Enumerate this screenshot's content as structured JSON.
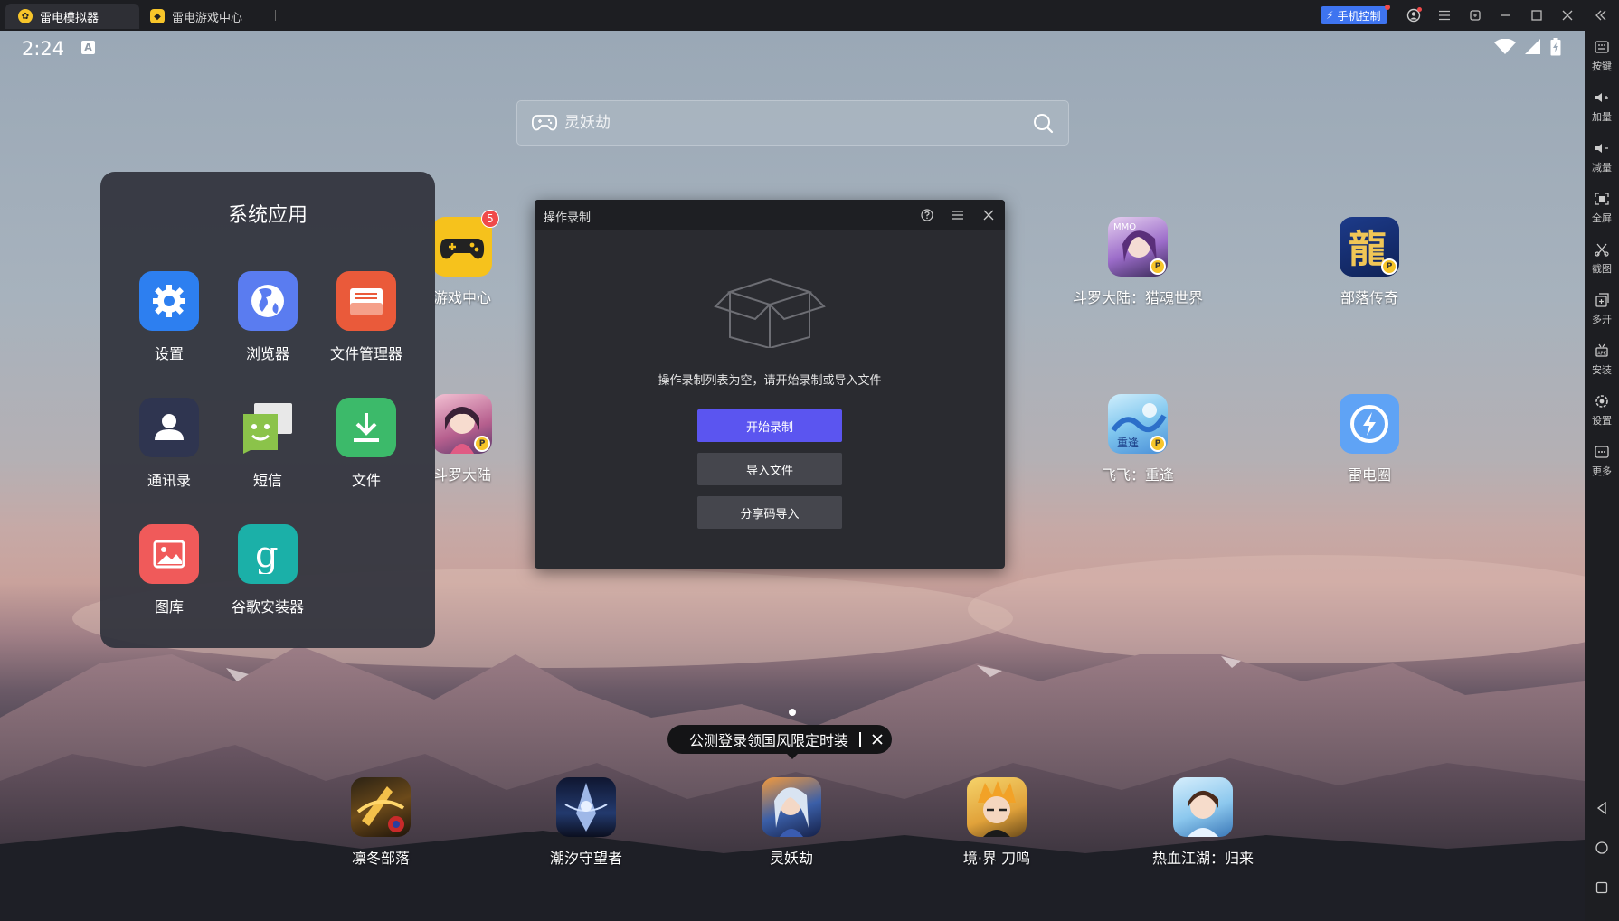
{
  "titlebar": {
    "tabs": [
      {
        "label": "雷电模拟器",
        "active": true
      },
      {
        "label": "雷电游戏中心",
        "active": false
      }
    ],
    "phone_control_label": "手机控制",
    "icons": [
      "account-icon",
      "menu-icon",
      "restore-icon",
      "minimize-icon",
      "maximize-icon",
      "close-icon",
      "collapse-icon"
    ]
  },
  "status_bar": {
    "time": "2:24",
    "a_badge": "A"
  },
  "search": {
    "placeholder": "灵妖劫"
  },
  "desktop_apps": [
    {
      "label": "游戏中心",
      "badge": "5"
    },
    {
      "label": "斗罗大陆"
    },
    {
      "label": "斗罗大陆：猎魂世界"
    },
    {
      "label": "部落传奇"
    },
    {
      "label": "飞飞：重逢"
    },
    {
      "label": "雷电圈"
    }
  ],
  "system_folder": {
    "title": "系统应用",
    "apps": [
      {
        "label": "设置",
        "color": "#2d7ff0"
      },
      {
        "label": "浏览器",
        "color": "#5a7cf0"
      },
      {
        "label": "文件管理器",
        "color": "#ea5a3a"
      },
      {
        "label": "通讯录",
        "color": "#2f3550"
      },
      {
        "label": "短信",
        "color": "#8bc34a"
      },
      {
        "label": "文件",
        "color": "#3cba6a"
      },
      {
        "label": "图库",
        "color": "#f05a5a"
      },
      {
        "label": "谷歌安装器",
        "color": "#1bb0a8"
      }
    ]
  },
  "dialog": {
    "title": "操作录制",
    "empty_text": "操作录制列表为空，请开始录制或导入文件",
    "start_label": "开始录制",
    "import_label": "导入文件",
    "share_code_label": "分享码导入"
  },
  "toast": {
    "text": "公测登录领国风限定时装"
  },
  "dock_apps": [
    {
      "label": "凛冬部落"
    },
    {
      "label": "潮汐守望者"
    },
    {
      "label": "灵妖劫"
    },
    {
      "label": "境·界 刀鸣"
    },
    {
      "label": "热血江湖：归来"
    }
  ],
  "sidebar": {
    "items": [
      {
        "label": "按键"
      },
      {
        "label": "加量"
      },
      {
        "label": "减量"
      },
      {
        "label": "全屏"
      },
      {
        "label": "截图"
      },
      {
        "label": "多开"
      },
      {
        "label": "安装"
      },
      {
        "label": "设置"
      },
      {
        "label": "更多"
      }
    ]
  },
  "colors": {
    "accent": "#5b55f0",
    "phone_control": "#3e74f0",
    "titlebar_bg": "#1d1e22"
  }
}
